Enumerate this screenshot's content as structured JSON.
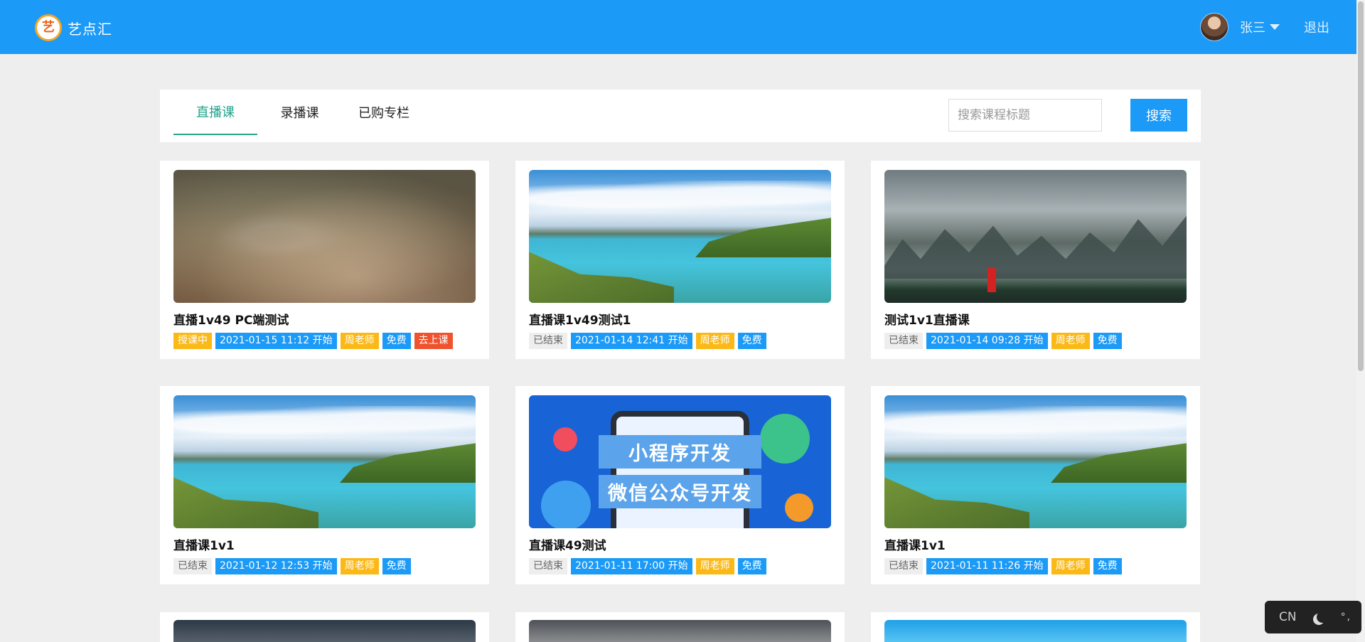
{
  "header": {
    "logo_mark": "艺",
    "app_name": "艺点汇",
    "username": "张三",
    "logout_label": "退出"
  },
  "tabs": [
    {
      "label": "直播课",
      "active": true
    },
    {
      "label": "录播课",
      "active": false
    },
    {
      "label": "已购专栏",
      "active": false
    }
  ],
  "search": {
    "placeholder": "搜索课程标题",
    "button_label": "搜索"
  },
  "courses": [
    {
      "title": "直播1v49 PC端测试",
      "status": "授课中",
      "time": "2021-01-15 11:12 开始",
      "teacher": "周老师",
      "price": "免费",
      "action": "去上课",
      "image": "blurred-bokeh"
    },
    {
      "title": "直播课1v49测试1",
      "status": "已结束",
      "time": "2021-01-14 12:41 开始",
      "teacher": "周老师",
      "price": "免费",
      "image": "lake-landscape"
    },
    {
      "title": "测试1v1直播课",
      "status": "已结束",
      "time": "2021-01-14 09:28 开始",
      "teacher": "周老师",
      "price": "免费",
      "image": "karst-mountains"
    },
    {
      "title": "直播课1v1",
      "status": "已结束",
      "time": "2021-01-12 12:53 开始",
      "teacher": "周老师",
      "price": "免费",
      "image": "lake-landscape"
    },
    {
      "title": "直播课49测试",
      "status": "已结束",
      "time": "2021-01-11 17:00 开始",
      "teacher": "周老师",
      "price": "免费",
      "image": "wechat-dev-banner",
      "image_text": [
        "小程序开发",
        "微信公众号开发"
      ]
    },
    {
      "title": "直播课1v1",
      "status": "已结束",
      "time": "2021-01-11 11:26 开始",
      "teacher": "周老师",
      "price": "免费",
      "image": "lake-landscape"
    }
  ],
  "partial_cards": [
    "dark-mountains",
    "grey-mountains",
    "blue-sky-flowers"
  ],
  "lang_widget": {
    "label": "CN",
    "extra": "°,"
  },
  "colors": {
    "header_bg": "#1b9af7",
    "tab_active": "#23a38a",
    "tag_blue": "#1b9af7",
    "tag_yellow": "#fbb917",
    "tag_red": "#f0522e"
  }
}
